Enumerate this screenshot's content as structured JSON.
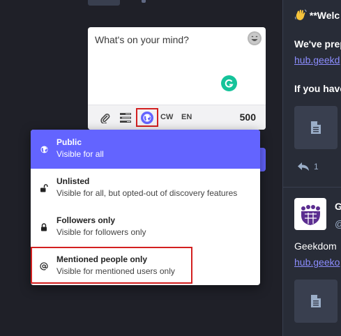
{
  "composer": {
    "placeholder": "What's on your mind?",
    "cw_label": "CW",
    "language": "EN",
    "char_count": "500",
    "emoji_icon": "emoji-icon",
    "grammarly_icon": "grammarly-icon"
  },
  "privacy_menu": {
    "options": [
      {
        "title": "Public",
        "description": "Visible for all",
        "icon": "globe-icon",
        "active": true
      },
      {
        "title": "Unlisted",
        "description": "Visible for all, but opted-out of discovery features",
        "icon": "unlock-icon",
        "active": false
      },
      {
        "title": "Followers only",
        "description": "Visible for followers only",
        "icon": "lock-icon",
        "active": false
      },
      {
        "title": "Mentioned people only",
        "description": "Visible for mentioned users only",
        "icon": "at-icon",
        "active": false
      }
    ]
  },
  "timeline": {
    "post1": {
      "heading": "**Welc",
      "line1": "We've prep",
      "link1": "hub.geekd",
      "line2": "If you have",
      "reply_count": "1"
    },
    "post2": {
      "author": "G",
      "handle": "@",
      "line1": "Geekdom",
      "link1": "hub.geeko"
    }
  },
  "colors": {
    "accent": "#6364ff",
    "highlight": "#d32020",
    "background": "#1f2028",
    "column": "#282c37"
  }
}
